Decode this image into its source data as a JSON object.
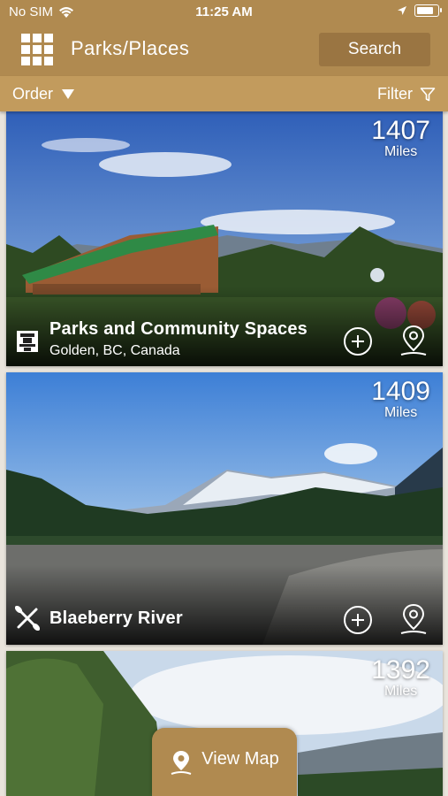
{
  "status_bar": {
    "carrier": "No SIM",
    "time": "11:25 AM"
  },
  "header": {
    "title": "Parks/Places",
    "menu_icon": "grid-icon",
    "search_label": "Search"
  },
  "filter_bar": {
    "order_label": "Order",
    "filter_label": "Filter"
  },
  "cards": [
    {
      "distance": "1407",
      "unit": "Miles",
      "name": "Parks and Community Spaces",
      "location": "Golden, BC, Canada",
      "category_icon": "totem-icon"
    },
    {
      "distance": "1409",
      "unit": "Miles",
      "name": "Blaeberry River",
      "location": "",
      "category_icon": "kayak-icon"
    },
    {
      "distance": "1392",
      "unit": "Miles",
      "name": "",
      "location": "",
      "category_icon": ""
    }
  ],
  "view_map": {
    "label": "View Map",
    "icon": "map-pin-icon"
  },
  "colors": {
    "primary": "#b08a50",
    "filter_bar": "#c29b5d",
    "search_button": "#9a7542"
  }
}
